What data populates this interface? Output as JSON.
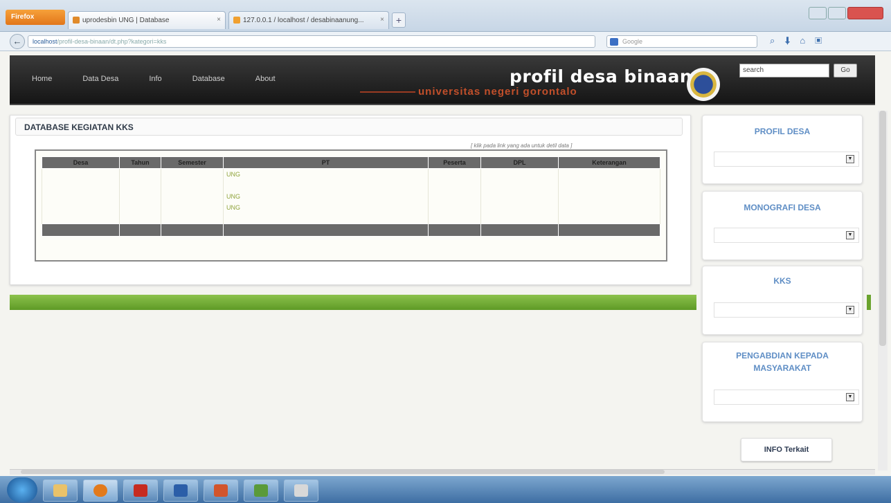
{
  "browser": {
    "app_button": "Firefox",
    "tabs": [
      {
        "label": "uprodesbin UNG | Database"
      },
      {
        "label": "127.0.0.1 / localhost / desabinaanung..."
      }
    ],
    "new_tab": "+",
    "url": {
      "host": "localhost",
      "path": "/profil-desa-binaan/dt.php?kategori=kks"
    },
    "search_engine": "Google"
  },
  "site": {
    "nav": [
      "Home",
      "Data Desa",
      "Info",
      "Database",
      "About"
    ],
    "title": "profil desa binaan",
    "subtitle": "universitas negeri gorontalo",
    "search_value": "search",
    "go_label": "Go"
  },
  "page": {
    "title": "DATABASE KEGIATAN KKS",
    "table_note": "[ klik pada link yang ada untuk detil data ]",
    "table": {
      "headers": [
        "Desa",
        "Tahun",
        "Semester",
        "PT",
        "Peserta",
        "DPL",
        "Keterangan"
      ],
      "rows": [
        [
          "",
          "",
          "",
          "UNG",
          "",
          "",
          ""
        ],
        [
          "",
          "",
          "",
          "",
          "",
          "",
          ""
        ],
        [
          "",
          "",
          "",
          "UNG",
          "",
          "",
          ""
        ],
        [
          "",
          "",
          "",
          "UNG",
          "",
          "",
          ""
        ],
        [
          "",
          "",
          "",
          "",
          "",
          "",
          ""
        ]
      ]
    },
    "footer": ""
  },
  "sidebar": [
    {
      "title": "PROFIL DESA",
      "select": ""
    },
    {
      "title": "MONOGRAFI DESA",
      "select": ""
    },
    {
      "title": "KKS",
      "select": ""
    },
    {
      "title": "PENGABDIAN KEPADA MASYARAKAT",
      "select": ""
    }
  ],
  "info_button": "INFO Terkait",
  "tray": {
    "lang": "",
    "time": "",
    "date": ""
  },
  "colors": {
    "accent_green": "#8cc24c",
    "header_dark": "#1f1f1f",
    "link_green": "#8fa33a",
    "sidebar_blue": "#5f8ec5",
    "subtitle_red": "#c24f2a"
  }
}
